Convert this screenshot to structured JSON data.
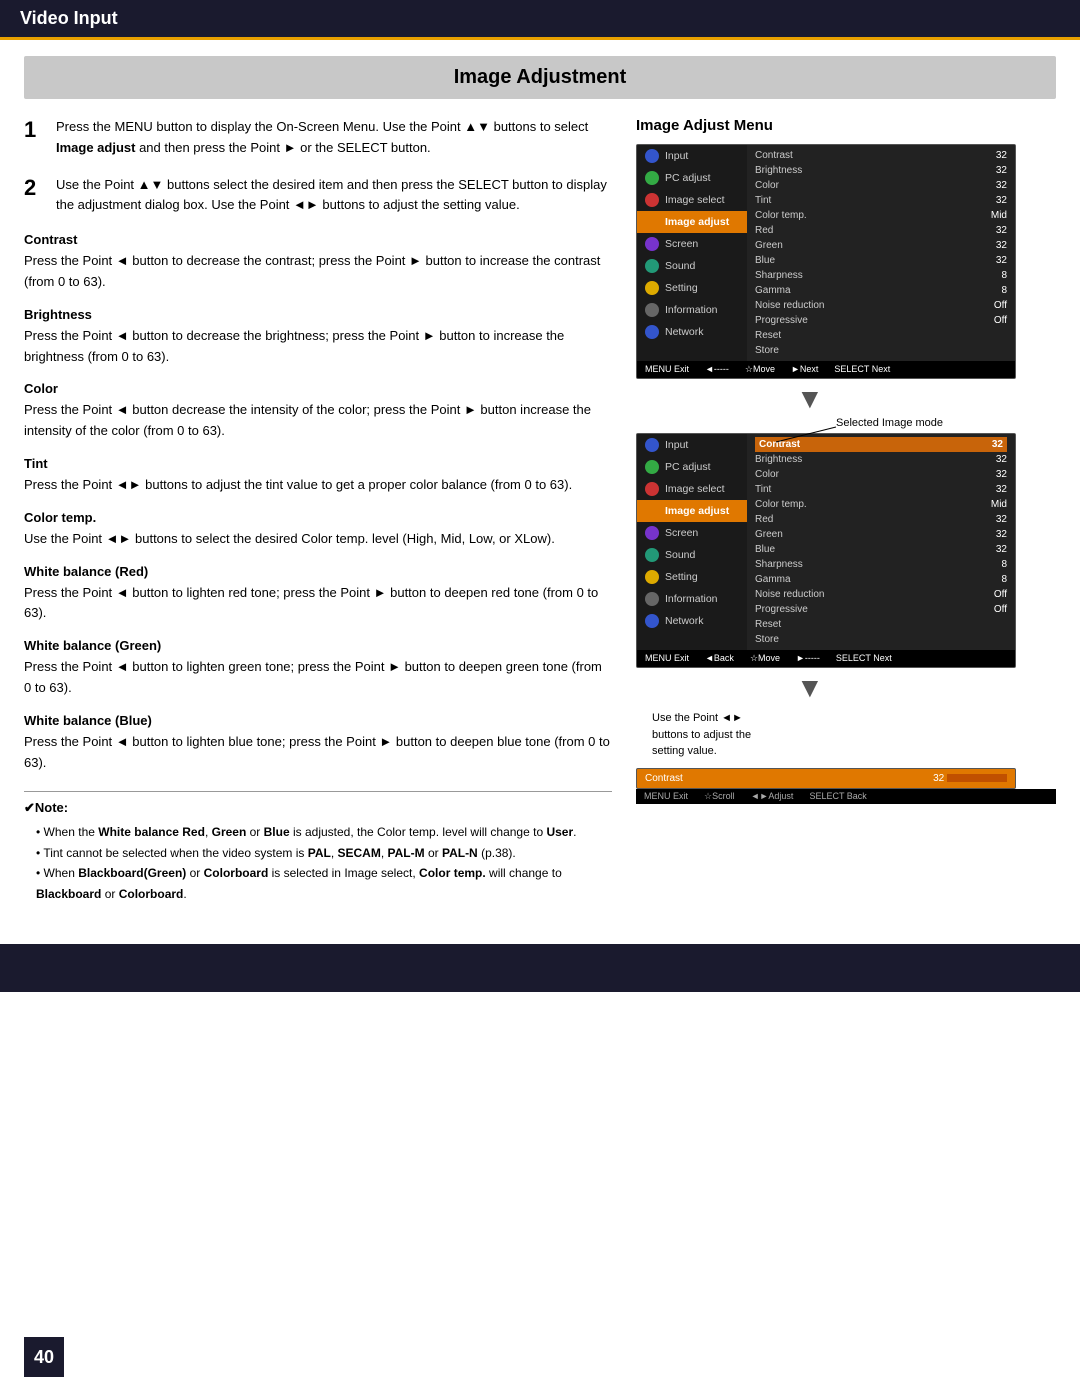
{
  "header": {
    "title": "Video Input"
  },
  "page": {
    "section_title": "Image Adjustment",
    "page_number": "40"
  },
  "steps": [
    {
      "num": "1",
      "text": "Press the MENU button to display the On-Screen Menu. Use the Point ▲▼ buttons to select Image adjust and then press the Point ► or the SELECT button."
    },
    {
      "num": "2",
      "text": "Use the Point ▲▼ buttons select the desired item and then press the SELECT button to display the adjustment dialog box. Use the Point ◄► buttons to adjust the setting value."
    }
  ],
  "subsections": [
    {
      "title": "Contrast",
      "body": "Press the Point ◄ button to decrease the contrast; press the Point ► button to increase the contrast (from 0 to 63)."
    },
    {
      "title": "Brightness",
      "body": "Press the Point ◄ button to decrease the brightness; press the Point ► button to increase the brightness (from 0 to 63)."
    },
    {
      "title": "Color",
      "body": "Press the Point ◄ button decrease the intensity of the color; press the Point ► button increase the intensity of the color (from 0 to 63)."
    },
    {
      "title": "Tint",
      "body": "Press the Point ◄► buttons to adjust the tint value to get a proper color balance (from 0 to 63)."
    },
    {
      "title": "Color temp.",
      "body": "Use the Point ◄► buttons to select the desired Color temp. level (High, Mid, Low, or XLow)."
    },
    {
      "title": "White balance (Red)",
      "body": "Press the Point ◄ button to lighten red tone; press the Point ► button to deepen red tone (from 0 to 63)."
    },
    {
      "title": "White balance (Green)",
      "body": "Press the Point ◄ button to lighten green tone; press the Point ► button to deepen green tone (from 0 to 63)."
    },
    {
      "title": "White balance (Blue)",
      "body": "Press the Point ◄ button to lighten blue tone; press the Point ► button to deepen blue tone (from 0 to 63)."
    }
  ],
  "right_col": {
    "menu_title": "Image Adjust Menu",
    "annotation": "Selected Image mode",
    "use_point_text": "Use the Point ◄►\nbuttons to adjust the\nsetting value."
  },
  "menu1": {
    "sidebar": [
      {
        "label": "Input",
        "icon": "blue",
        "active": false
      },
      {
        "label": "PC adjust",
        "icon": "green",
        "active": false
      },
      {
        "label": "Image select",
        "icon": "red",
        "active": false
      },
      {
        "label": "Image adjust",
        "icon": "orange",
        "active": true
      },
      {
        "label": "Screen",
        "icon": "purple",
        "active": false
      },
      {
        "label": "Sound",
        "icon": "teal",
        "active": false
      },
      {
        "label": "Setting",
        "icon": "yellow",
        "active": false
      },
      {
        "label": "Information",
        "icon": "gray",
        "active": false
      },
      {
        "label": "Network",
        "icon": "blue2",
        "active": false
      }
    ],
    "items": [
      {
        "label": "Contrast",
        "value": "32",
        "highlight": false
      },
      {
        "label": "Brightness",
        "value": "32",
        "highlight": false
      },
      {
        "label": "Color",
        "value": "32",
        "highlight": false
      },
      {
        "label": "Tint",
        "value": "32",
        "highlight": false
      },
      {
        "label": "Color temp.",
        "value": "Mid",
        "highlight": false
      },
      {
        "label": "Red",
        "value": "32",
        "highlight": false
      },
      {
        "label": "Green",
        "value": "32",
        "highlight": false
      },
      {
        "label": "Blue",
        "value": "32",
        "highlight": false
      },
      {
        "label": "Sharpness",
        "value": "8",
        "highlight": false
      },
      {
        "label": "Gamma",
        "value": "8",
        "highlight": false
      },
      {
        "label": "Noise reduction",
        "value": "Off",
        "highlight": false
      },
      {
        "label": "Progressive",
        "value": "Off",
        "highlight": false
      },
      {
        "label": "Reset",
        "value": "",
        "highlight": false
      },
      {
        "label": "Store",
        "value": "",
        "highlight": false
      }
    ],
    "footer": "MENU Exit  ◄-----  ☆Move  ►Next  SELECT Next"
  },
  "menu2": {
    "items": [
      {
        "label": "Contrast",
        "value": "32",
        "highlight": true
      },
      {
        "label": "Brightness",
        "value": "32",
        "highlight": false
      },
      {
        "label": "Color",
        "value": "32",
        "highlight": false
      },
      {
        "label": "Tint",
        "value": "32",
        "highlight": false
      },
      {
        "label": "Color temp.",
        "value": "Mid",
        "highlight": false
      },
      {
        "label": "Red",
        "value": "32",
        "highlight": false
      },
      {
        "label": "Green",
        "value": "32",
        "highlight": false
      },
      {
        "label": "Blue",
        "value": "32",
        "highlight": false
      },
      {
        "label": "Sharpness",
        "value": "8",
        "highlight": false
      },
      {
        "label": "Gamma",
        "value": "8",
        "highlight": false
      },
      {
        "label": "Noise reduction",
        "value": "Off",
        "highlight": false
      },
      {
        "label": "Progressive",
        "value": "Off",
        "highlight": false
      },
      {
        "label": "Reset",
        "value": "",
        "highlight": false
      },
      {
        "label": "Store",
        "value": "",
        "highlight": false
      }
    ],
    "footer": "MENU Exit  ◄Back  ☆Move  ►-----  SELECT Next"
  },
  "mini_bar": {
    "label": "Contrast",
    "value": "32",
    "footer": "MENU Exit  ☆Scroll  ◄►Adjust  SELECT Back"
  },
  "note": {
    "title": "✔Note:",
    "items": [
      "When the White balance Red, Green or Blue is adjusted, the Color temp. level will change to User.",
      "Tint cannot be selected when the video system is PAL, SECAM, PAL-M or PAL-N (p.38).",
      "When Blackboard(Green) or Colorboard is selected in Image select, Color temp. will change to Blackboard or Colorboard."
    ]
  }
}
